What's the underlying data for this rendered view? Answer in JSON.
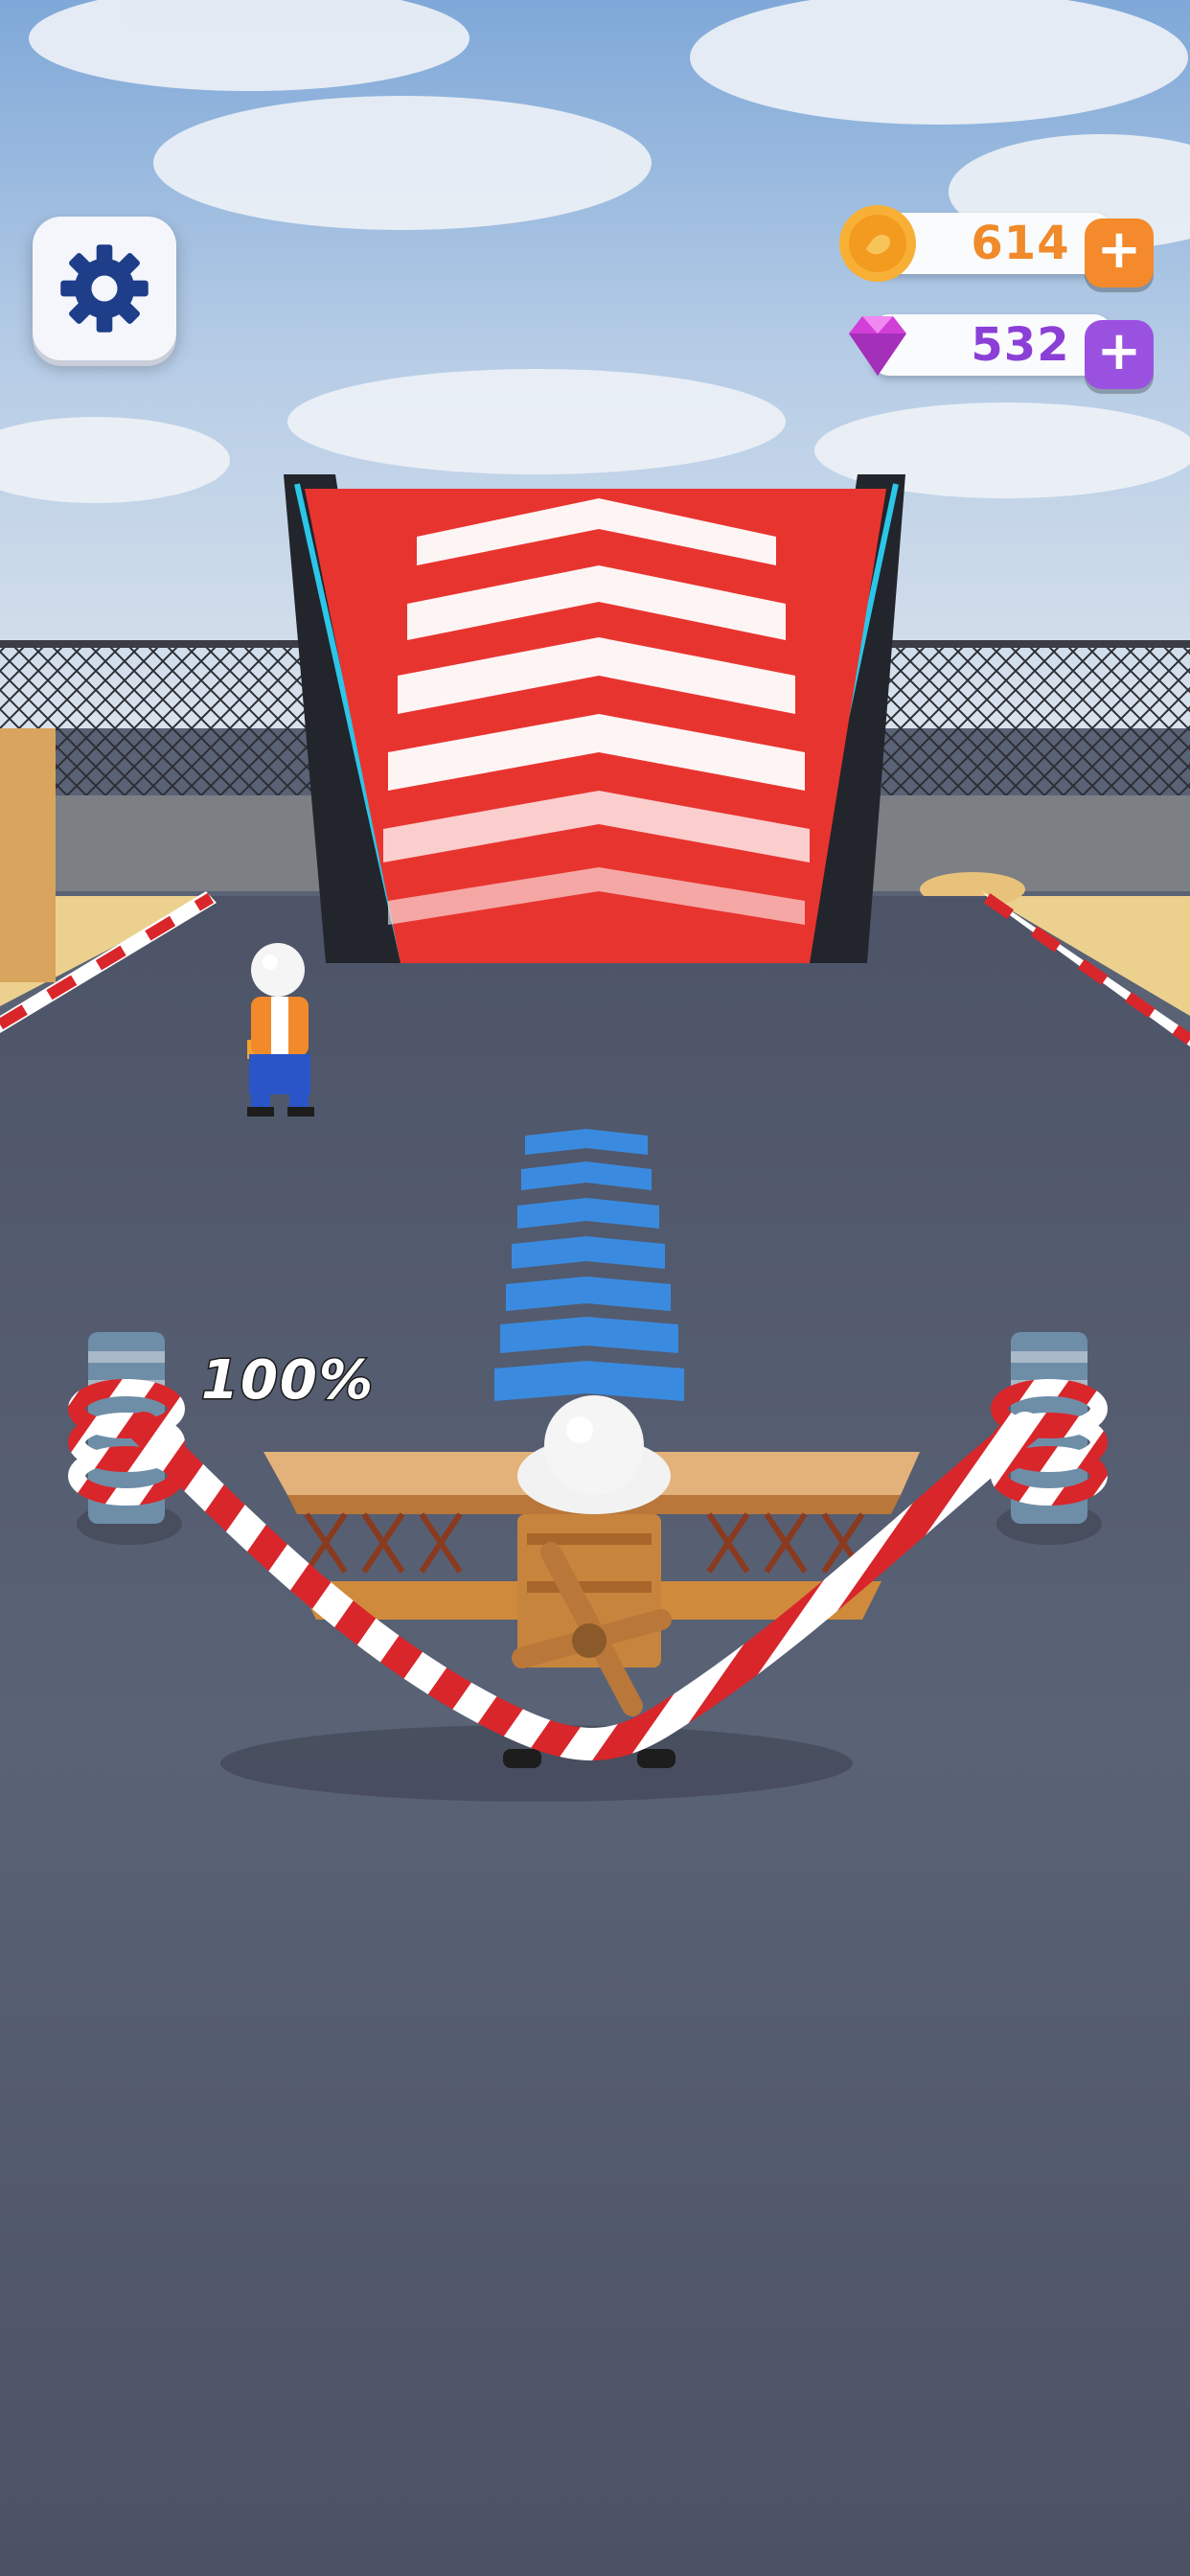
{
  "hud": {
    "coins": "614",
    "gems": "532",
    "plus_symbol": "+",
    "launch_power": "100%"
  },
  "icons": {
    "settings": "gear-icon",
    "coin": "coin-icon",
    "gem": "gem-icon",
    "add": "plus-icon"
  },
  "colors": {
    "coin_accent": "#f08a2a",
    "gem_accent": "#9b51e0",
    "ramp_red": "#e8342f",
    "road": "#545b6d",
    "sky": "#b9d0ea"
  }
}
